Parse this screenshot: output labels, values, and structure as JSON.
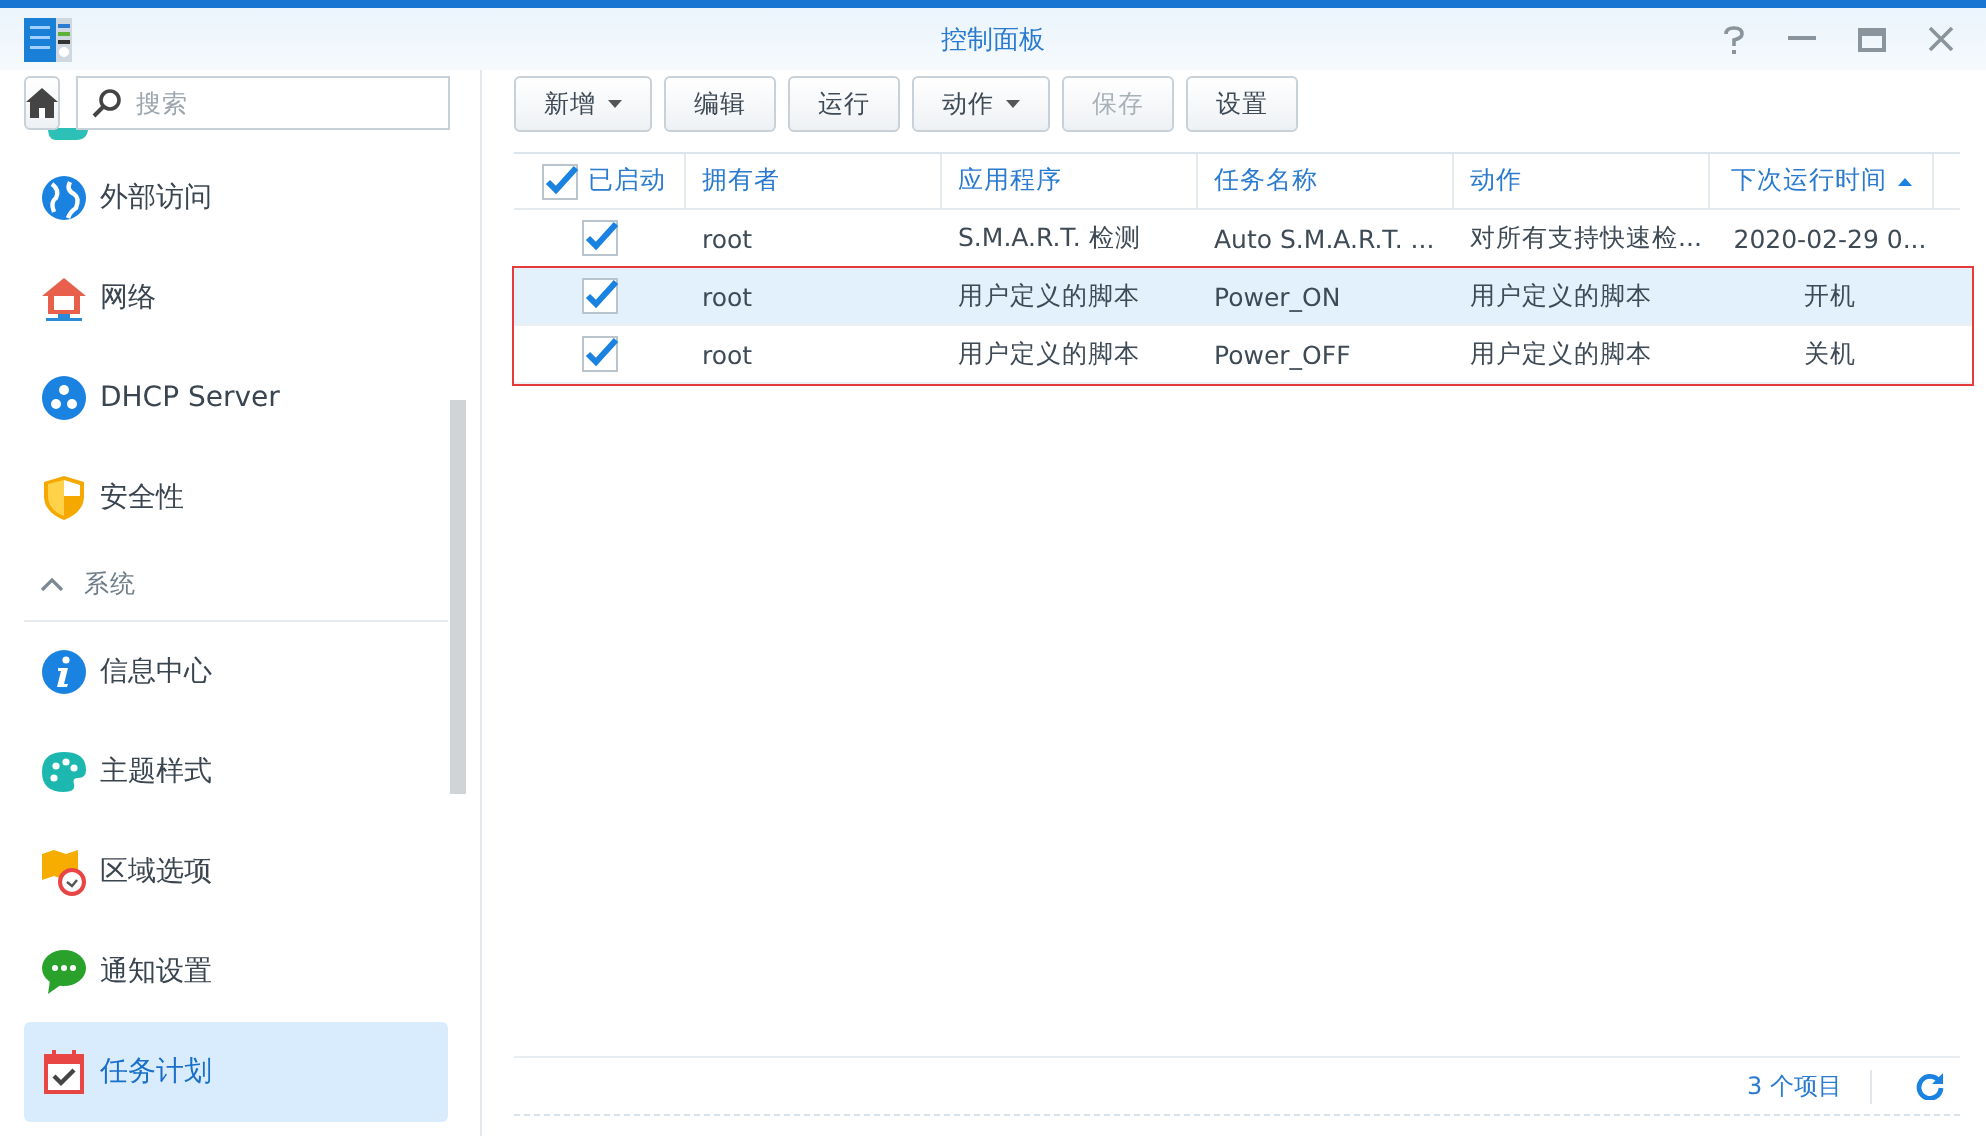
{
  "window": {
    "title": "控制面板"
  },
  "sidebar": {
    "search": {
      "placeholder": "搜索"
    },
    "items": [
      {
        "kind": "item",
        "label": "外部访问",
        "selected": false
      },
      {
        "kind": "item",
        "label": "网络",
        "selected": false
      },
      {
        "kind": "item",
        "label": "DHCP Server",
        "selected": false
      },
      {
        "kind": "item",
        "label": "安全性",
        "selected": false
      },
      {
        "kind": "section",
        "label": "系统",
        "expanded": true
      },
      {
        "kind": "item",
        "label": "信息中心",
        "selected": false
      },
      {
        "kind": "item",
        "label": "主题样式",
        "selected": false
      },
      {
        "kind": "item",
        "label": "区域选项",
        "selected": false
      },
      {
        "kind": "item",
        "label": "通知设置",
        "selected": false
      },
      {
        "kind": "item",
        "label": "任务计划",
        "selected": true
      }
    ]
  },
  "toolbar": [
    {
      "label": "新增",
      "dropdown": true,
      "disabled": false
    },
    {
      "label": "编辑",
      "dropdown": false,
      "disabled": false
    },
    {
      "label": "运行",
      "dropdown": false,
      "disabled": false
    },
    {
      "label": "动作",
      "dropdown": true,
      "disabled": false
    },
    {
      "label": "保存",
      "dropdown": false,
      "disabled": true
    },
    {
      "label": "设置",
      "dropdown": false,
      "disabled": false
    }
  ],
  "table": {
    "columns": [
      {
        "label": "已启动",
        "sorted": false,
        "checked": true
      },
      {
        "label": "拥有者",
        "sorted": false
      },
      {
        "label": "应用程序",
        "sorted": false
      },
      {
        "label": "任务名称",
        "sorted": false
      },
      {
        "label": "动作",
        "sorted": false
      },
      {
        "label": "下次运行时间",
        "sorted": true
      }
    ],
    "rows": [
      {
        "selected": false,
        "outlined": false,
        "cells": [
          {
            "checked": true
          },
          "root",
          "S.M.A.R.T. 检测",
          "Auto S.M.A.R.T. ...",
          "对所有支持快速检...",
          "2020-02-29 0..."
        ]
      },
      {
        "selected": true,
        "outlined": true,
        "cells": [
          {
            "checked": true
          },
          "root",
          "用户定义的脚本",
          "Power_ON",
          "用户定义的脚本",
          "开机"
        ]
      },
      {
        "selected": false,
        "outlined": true,
        "cells": [
          {
            "checked": true
          },
          "root",
          "用户定义的脚本",
          "Power_OFF",
          "用户定义的脚本",
          "关机"
        ]
      }
    ]
  },
  "status_bar": {
    "count": "3 个项目"
  }
}
